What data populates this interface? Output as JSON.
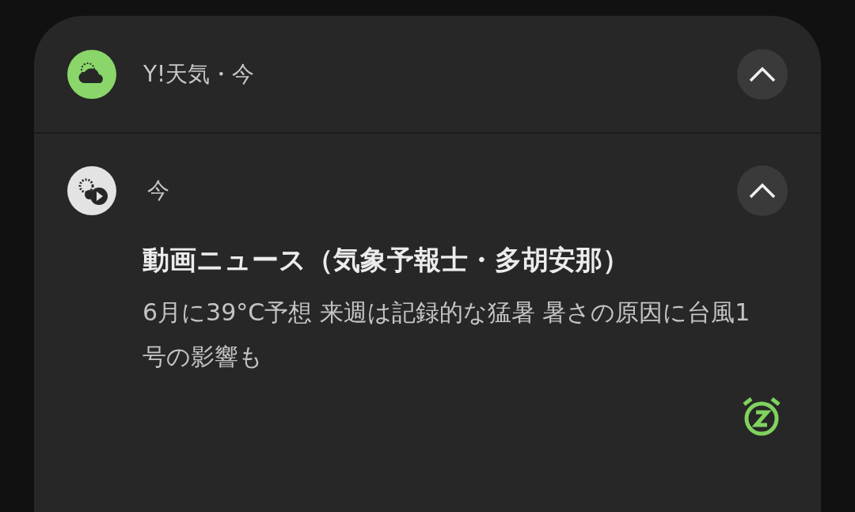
{
  "group_header": {
    "app_name": "Y!天気・今",
    "expanded": true
  },
  "notification": {
    "time": "今",
    "expanded": true,
    "title": "動画ニュース（気象予報士・多胡安那）",
    "body": "6月に39°C予想 来週は記録的な猛暑 暑さの原因に台風1号の影響も"
  }
}
